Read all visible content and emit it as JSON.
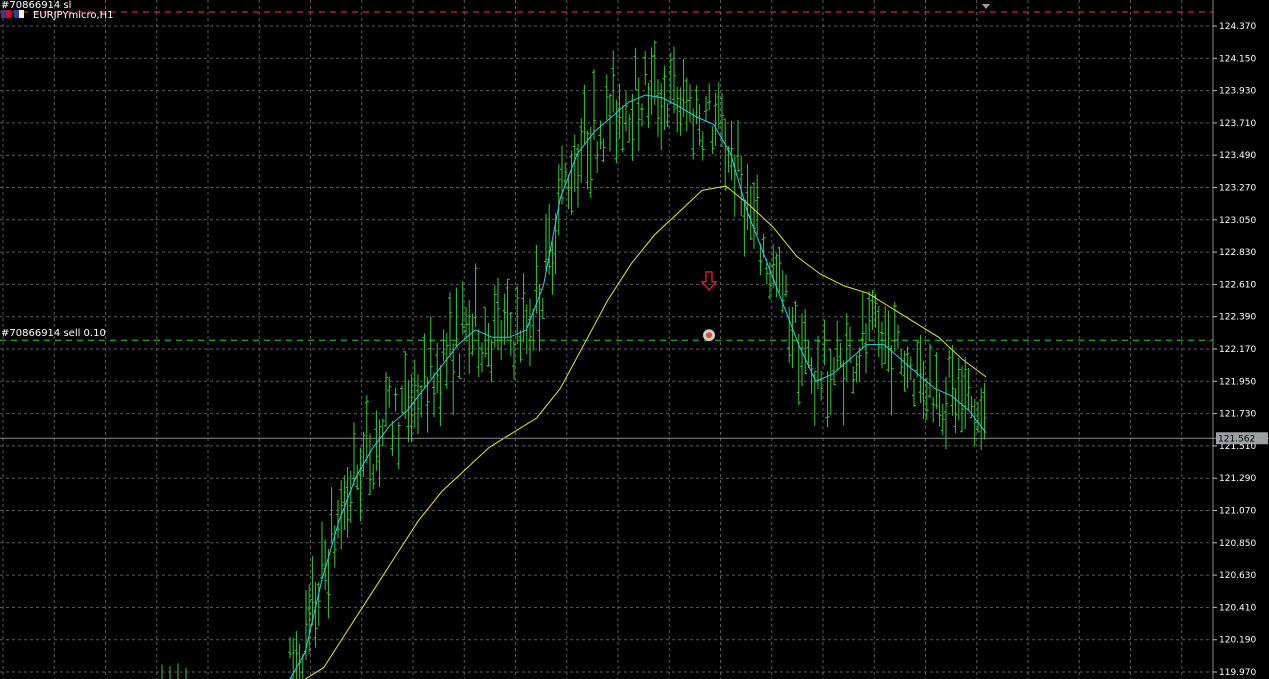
{
  "header": {
    "order_label": "#70866914 sl",
    "symbol_timeframe": "EURJPYmicro,H1"
  },
  "order_line_label": "#70866914 sell 0.10",
  "current_price_label": "121.562",
  "colors": {
    "background": "#000000",
    "grid": "#5a5a5a",
    "bars": "#33cc33",
    "ma_fast": "#22d3f0",
    "ma_slow": "#e6e62e",
    "order_line": "#2bd12b",
    "stop_loss_line": "#ff3030",
    "current_price_line": "#8c8c8c",
    "sell_arrow": "#ff2020"
  },
  "icons": {
    "flags": "flag-icon",
    "sell_arrow": "down-arrow-icon",
    "order_marker": "close-marker-icon"
  },
  "chart_data": {
    "type": "line",
    "ylim": [
      119.97,
      124.37
    ],
    "y_ticks": [
      "124.370",
      "124.150",
      "123.930",
      "123.710",
      "123.490",
      "123.270",
      "123.050",
      "122.830",
      "122.610",
      "122.390",
      "122.170",
      "121.950",
      "121.730",
      "121.510",
      "121.290",
      "121.070",
      "120.850",
      "120.630",
      "120.410",
      "120.190",
      "119.970"
    ],
    "current_price": 121.562,
    "order_price": 122.23,
    "stop_loss_price": 124.46,
    "sell_entry_price": 122.6,
    "ma_fast": [
      119.9,
      120.1,
      120.6,
      121.0,
      121.3,
      121.5,
      121.65,
      121.75,
      121.9,
      122.05,
      122.2,
      122.3,
      122.25,
      122.25,
      122.3,
      122.6,
      123.2,
      123.5,
      123.65,
      123.75,
      123.85,
      123.9,
      123.88,
      123.82,
      123.75,
      123.7,
      123.5,
      123.1,
      122.8,
      122.5,
      122.2,
      121.95,
      122.0,
      122.1,
      122.2,
      122.2,
      122.1,
      122.0,
      121.9,
      121.85,
      121.75,
      121.6
    ],
    "ma_slow": [
      119.9,
      120.0,
      120.25,
      120.5,
      120.75,
      121.0,
      121.2,
      121.35,
      121.5,
      121.6,
      121.7,
      121.9,
      122.2,
      122.5,
      122.75,
      122.95,
      123.1,
      123.25,
      123.28,
      123.15,
      123.0,
      122.8,
      122.68,
      122.6,
      122.55,
      122.45,
      122.35,
      122.25,
      122.1,
      121.98
    ]
  }
}
